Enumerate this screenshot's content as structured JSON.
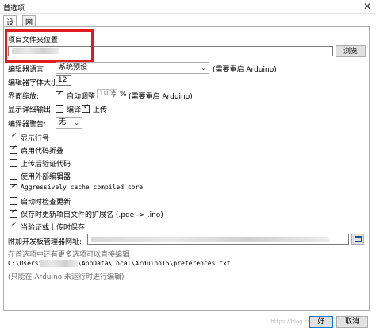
{
  "window": {
    "title": "首选项",
    "close": "✕"
  },
  "tabs": [
    {
      "label": "设置",
      "active": true
    },
    {
      "label": "网络",
      "active": false
    }
  ],
  "sketchbook": {
    "label": "项目文件夹位置",
    "value": "",
    "browse_label": "浏览"
  },
  "editor_language": {
    "label": "编辑器语言",
    "value": "系统预设",
    "note": "(需要重启 Arduino)"
  },
  "font_size": {
    "label": "编辑器字体大小",
    "value": "12"
  },
  "scale": {
    "label": "界面缩放:",
    "auto_label": "自动调整",
    "auto_checked": true,
    "value": "100",
    "unit": "%",
    "note": "(需要重启 Arduino)"
  },
  "verbose": {
    "label": "显示详细输出:",
    "compile_label": "编译",
    "compile_checked": false,
    "upload_label": "上传",
    "upload_checked": true
  },
  "warnings": {
    "label": "编译器警告:",
    "value": "无"
  },
  "options": [
    {
      "label": "显示行号",
      "checked": true
    },
    {
      "label": "启用代码折叠",
      "checked": true
    },
    {
      "label": "上传后验证代码",
      "checked": false
    },
    {
      "label": "使用外部编辑器",
      "checked": false
    },
    {
      "label": "Aggressively cache compiled core",
      "checked": true,
      "mono": true
    },
    {
      "label": "启动时检查更新",
      "checked": false
    },
    {
      "label": "保存时更新项目文件的扩展名 (.pde -> .ino)",
      "checked": true
    },
    {
      "label": "当验证或上传时保存",
      "checked": true
    }
  ],
  "board_manager": {
    "label": "附加开发板管理器网址:",
    "value": ""
  },
  "more_prefs": {
    "hint": "在首选项中还有更多选项可以直接编辑",
    "path_prefix": "C:\\Users\\",
    "path_suffix": "\\AppData\\Local\\Arduino15\\preferences.txt",
    "note": "(只能在 Arduino 未运行时进行编辑)"
  },
  "footer": {
    "ok_label": "好",
    "cancel_label": "取消",
    "watermark": "https://blog.csdn.net"
  }
}
